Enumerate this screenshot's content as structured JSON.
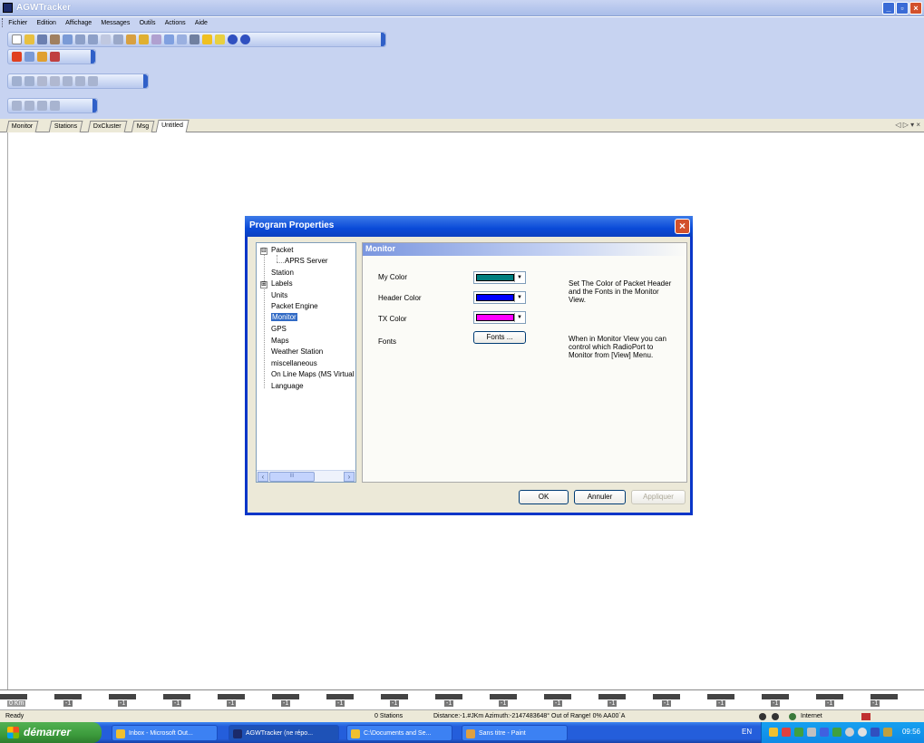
{
  "window": {
    "title": "AGWTracker"
  },
  "menu": [
    "Fichier",
    "Edition",
    "Affichage",
    "Messages",
    "Outils",
    "Actions",
    "Aide"
  ],
  "tabs": [
    "Monitor",
    "Stations",
    "DxCluster",
    "Msg",
    "Untitled"
  ],
  "tab_nav": "◁ ▷ ▾ ×",
  "dialog": {
    "title": "Program Properties",
    "tree": {
      "items": [
        "Packet",
        "APRS Server",
        "Station",
        "Labels",
        "Units",
        "Packet Engine",
        "Monitor",
        "GPS",
        "Maps",
        "Weather Station",
        "miscellaneous",
        "On Line Maps (MS Virtual",
        "Language"
      ],
      "expanders": [
        "⊟",
        "⊞"
      ],
      "scroll_thumb": "III"
    },
    "panel": {
      "header": "Monitor",
      "my_color_label": "My Color",
      "header_color_label": "Header Color",
      "tx_color_label": "TX Color",
      "fonts_label": "Fonts",
      "fonts_button": "Fonts ...",
      "help1": "Set The Color of Packet Header and the Fonts in  the Monitor View.",
      "help2": "When in Monitor View you can control which RadioPort to Monitor from [View] Menu.",
      "my_color": "#007f7f",
      "header_color": "#0000ff",
      "tx_color": "#ff00ff"
    },
    "buttons": {
      "ok": "OK",
      "cancel": "Annuler",
      "apply": "Appliquer"
    }
  },
  "ruler": {
    "start": "0 Km",
    "tick": "-1"
  },
  "status": {
    "ready": "Ready",
    "stations": "0 Stations",
    "distance": "Distance:-1.#JKm Azimuth:-2147483648° Out of Range! 0% AA00`A",
    "zone": "Internet"
  },
  "taskbar": {
    "start": "démarrer",
    "tasks": [
      "Inbox - Microsoft Out...",
      "AGWTracker (ne répo...",
      "C:\\Documents and Se...",
      "Sans titre - Paint"
    ],
    "lang": "EN",
    "clock": "09:56"
  }
}
